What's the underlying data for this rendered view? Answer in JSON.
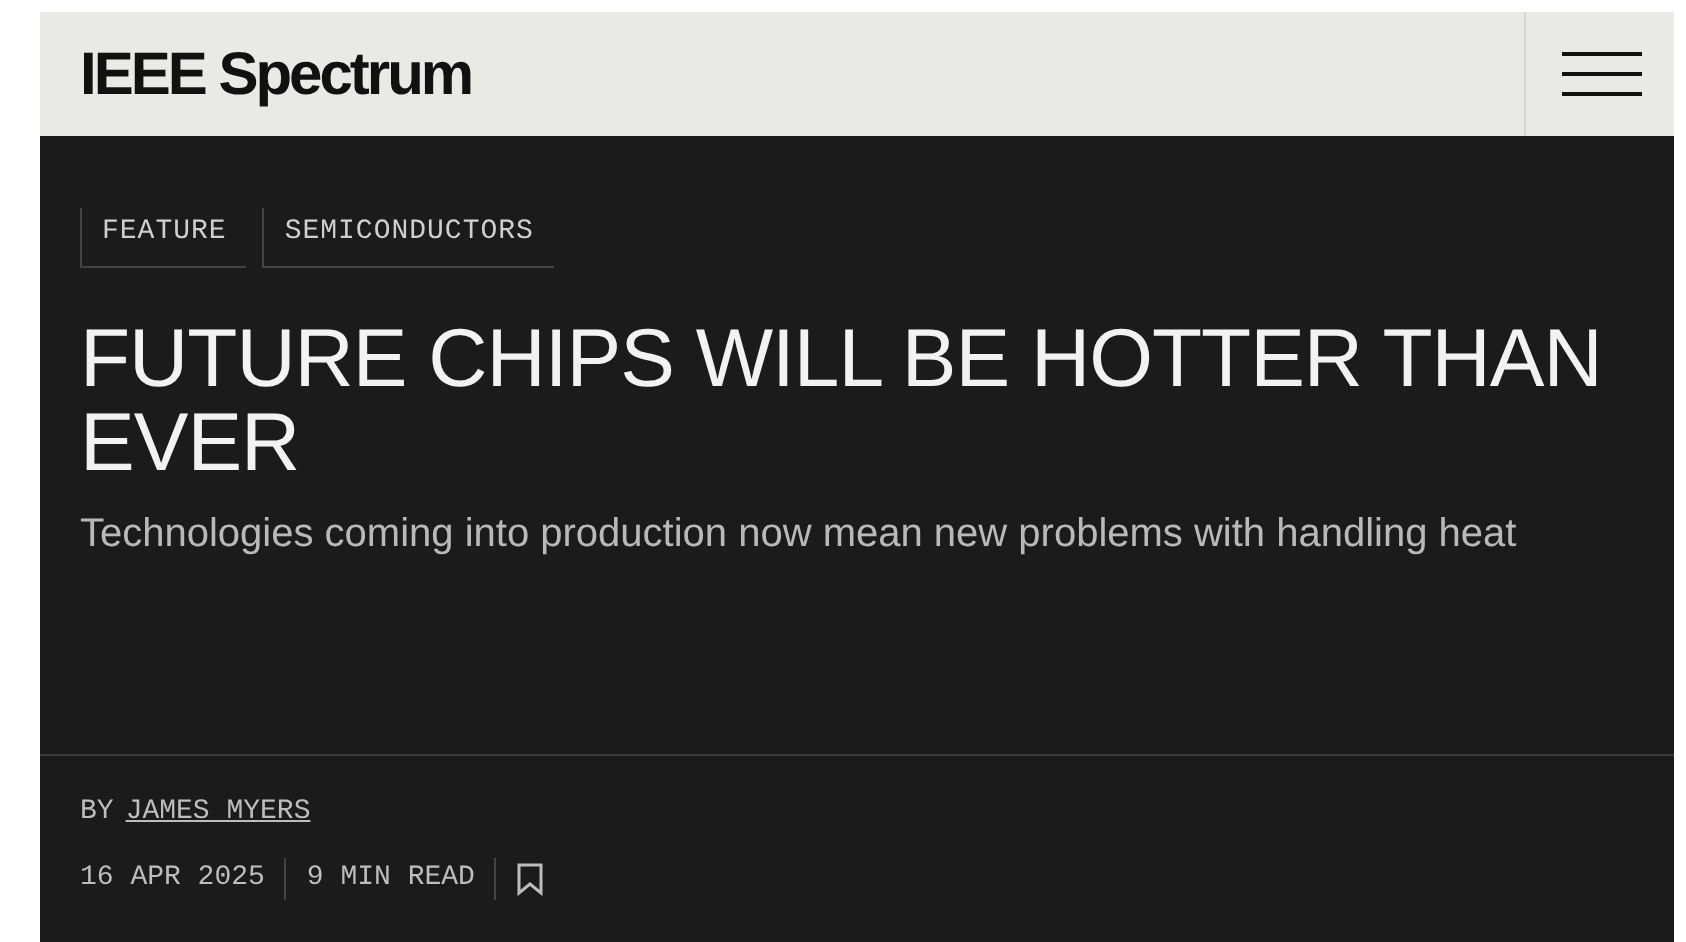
{
  "header": {
    "logo": "IEEE Spectrum"
  },
  "article": {
    "tags": [
      "FEATURE",
      "SEMICONDUCTORS"
    ],
    "title": "FUTURE CHIPS WILL BE HOTTER THAN EVER",
    "subtitle": "Technologies coming into production now mean new problems with handling heat",
    "byline_prefix": "BY",
    "author": "JAMES MYERS",
    "date": "16 APR 2025",
    "read_time": "9 MIN READ"
  }
}
